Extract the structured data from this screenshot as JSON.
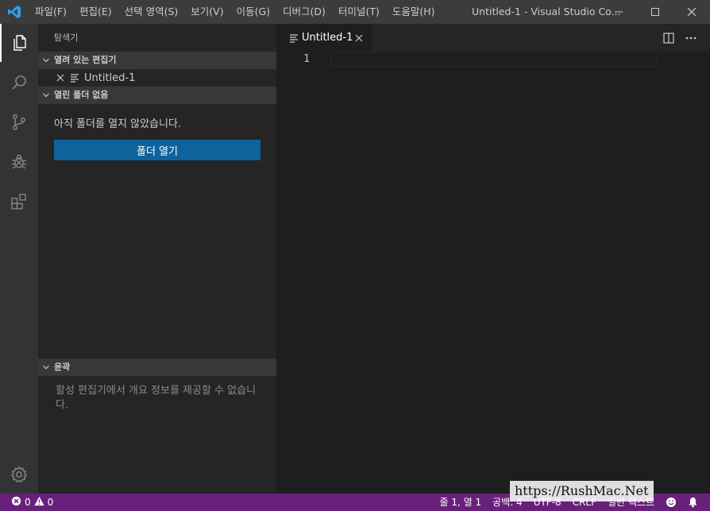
{
  "titlebar": {
    "menu": [
      "파일(F)",
      "편집(E)",
      "선택 영역(S)",
      "보기(V)",
      "이동(G)",
      "디버그(D)",
      "터미널(T)",
      "도움말(H)"
    ],
    "window_title": "Untitled-1 - Visual Studio Co...",
    "controls": [
      "minimize-icon",
      "maximize-icon",
      "close-icon"
    ]
  },
  "activitybar": {
    "items": [
      "files-icon",
      "search-icon",
      "source-control-icon",
      "debug-icon",
      "extensions-icon"
    ],
    "bottom": "gear-icon"
  },
  "sidebar": {
    "title": "탐색기",
    "open_editors": {
      "header": "열려 있는 편집기",
      "files": [
        "Untitled-1"
      ]
    },
    "no_folder": {
      "header": "열린 폴더 없음",
      "message": "아직 폴더를 열지 않았습니다.",
      "button": "폴더 열기"
    },
    "outline": {
      "header": "윤곽",
      "message": "활성 편집기에서 개요 정보를 제공할 수 없습니다."
    }
  },
  "editor": {
    "tab_label": "Untitled-1",
    "line_number": "1",
    "actions": [
      "split-editor-icon",
      "more-icon"
    ]
  },
  "statusbar": {
    "errors": "0",
    "warnings": "0",
    "position": "줄 1, 열 1",
    "indent": "공백: 4",
    "encoding": "UTF-8",
    "eol": "CRLF",
    "language": "일반 텍스트",
    "accent_color": "#68217a"
  },
  "watermark": "https://RushMac.Net"
}
